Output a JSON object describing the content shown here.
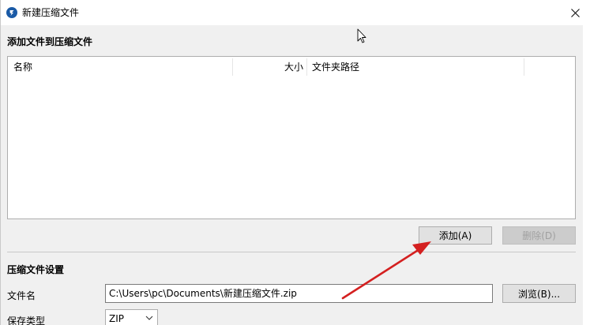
{
  "window": {
    "title": "新建压缩文件"
  },
  "add_section": {
    "heading": "添加文件到压缩文件",
    "columns": {
      "name": "名称",
      "size": "大小",
      "path": "文件夹路径"
    },
    "add_button": "添加(A)",
    "delete_button": "删除(D)"
  },
  "settings_section": {
    "heading": "压缩文件设置",
    "filename_label": "文件名",
    "filename_value": "C:\\Users\\pc\\Documents\\新建压缩文件.zip",
    "browse_button": "浏览(B)...",
    "type_label": "保存类型",
    "type_value": "ZIP"
  },
  "colors": {
    "accent": "#1a5aa6",
    "annotation_arrow": "#d42020"
  },
  "icons": {
    "app": "app-logo-icon",
    "close": "close-icon",
    "dropdown": "chevron-down-icon",
    "cursor": "mouse-pointer-icon"
  }
}
